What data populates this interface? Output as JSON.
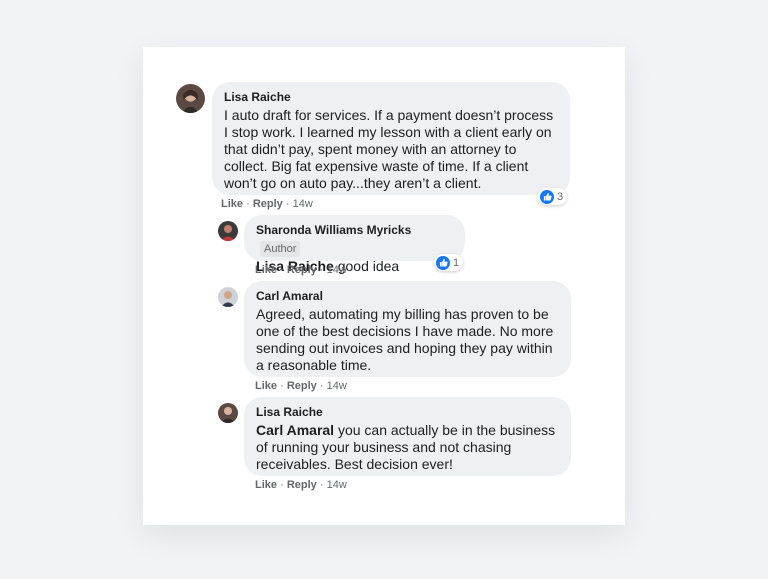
{
  "comments": [
    {
      "author": "Lisa Raiche",
      "text": "I auto draft for services. If a payment doesn’t process I stop work. I learned my lesson with a client early on that didn’t pay, spent money with an attorney to collect. Big fat expensive waste of time. If a client won’t go on auto pay...they aren’t a client.",
      "like_label": "Like",
      "reply_label": "Reply",
      "time": "14w",
      "reaction_count": "3"
    }
  ],
  "replies": [
    {
      "author": "Sharonda Williams Myricks",
      "badge": "Author",
      "mention": "Lisa Raiche",
      "text": "good idea",
      "like_label": "Like",
      "reply_label": "Reply",
      "time": "14w",
      "reaction_count": "1"
    },
    {
      "author": "Carl Amaral",
      "text": "Agreed, automating my billing has proven to be one of the best decisions I have made. No more sending out invoices and hoping they pay within a reasonable time.",
      "like_label": "Like",
      "reply_label": "Reply",
      "time": "14w"
    },
    {
      "author": "Lisa Raiche",
      "mention": "Carl Amaral",
      "text": "you can actually be in the business of running your business and not chasing receivables. Best decision ever!",
      "like_label": "Like",
      "reply_label": "Reply",
      "time": "14w"
    }
  ],
  "separator": "·",
  "colors": {
    "accent": "#1877f2",
    "bubble": "#eef0f3",
    "text": "#1c1e21",
    "muted": "#65676b"
  }
}
